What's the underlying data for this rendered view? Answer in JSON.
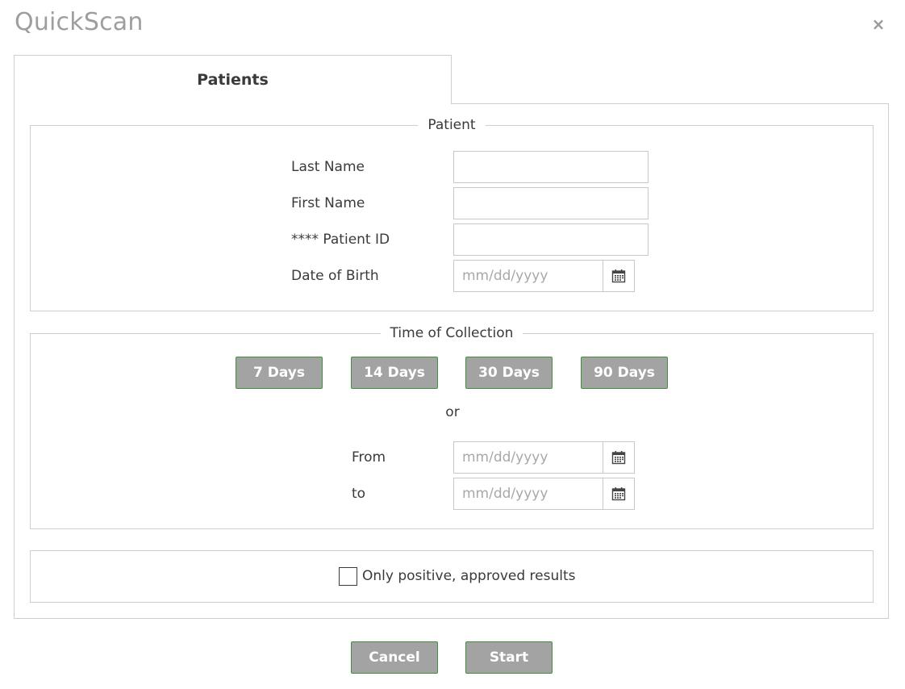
{
  "dialog": {
    "title": "QuickScan",
    "close_symbol": "×"
  },
  "tabs": [
    {
      "label": "Patients",
      "active": true
    }
  ],
  "patient_section": {
    "legend": "Patient",
    "fields": {
      "last_name": {
        "label": "Last Name",
        "value": ""
      },
      "first_name": {
        "label": "First Name",
        "value": ""
      },
      "patient_id": {
        "label": "**** Patient ID",
        "value": ""
      },
      "dob": {
        "label": "Date of Birth",
        "value": "",
        "placeholder": "mm/dd/yyyy"
      }
    }
  },
  "collection_section": {
    "legend": "Time of Collection",
    "presets": [
      {
        "label": "7 Days"
      },
      {
        "label": "14 Days"
      },
      {
        "label": "30 Days"
      },
      {
        "label": "90 Days"
      }
    ],
    "or_text": "or",
    "from": {
      "label": "From",
      "value": "",
      "placeholder": "mm/dd/yyyy"
    },
    "to": {
      "label": "to",
      "value": "",
      "placeholder": "mm/dd/yyyy"
    }
  },
  "filter": {
    "label": "Only positive, approved results",
    "checked": false
  },
  "footer": {
    "cancel_label": "Cancel",
    "start_label": "Start"
  },
  "colors": {
    "button_bg": "#a3a3a3",
    "button_border": "#3f8f3f",
    "border": "#cfcfcf",
    "title": "#9e9e9e"
  },
  "icons": {
    "calendar": "calendar-icon",
    "close": "close-icon"
  }
}
